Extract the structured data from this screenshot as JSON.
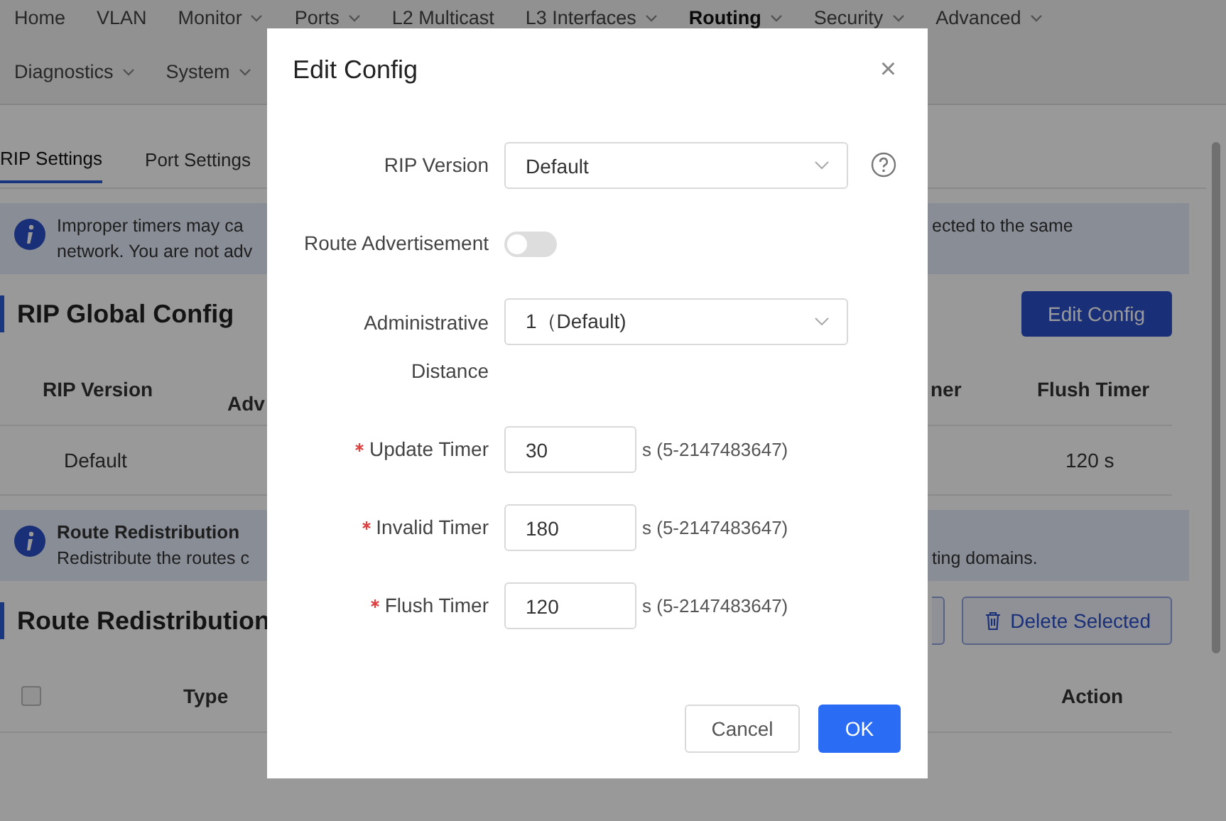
{
  "nav": [
    {
      "label": "Home",
      "has_menu": false,
      "selected": false
    },
    {
      "label": "VLAN",
      "has_menu": false,
      "selected": false
    },
    {
      "label": "Monitor",
      "has_menu": true,
      "selected": false
    },
    {
      "label": "Ports",
      "has_menu": true,
      "selected": false
    },
    {
      "label": "L2 Multicast",
      "has_menu": false,
      "selected": false
    },
    {
      "label": "L3 Interfaces",
      "has_menu": true,
      "selected": false
    },
    {
      "label": "Routing",
      "has_menu": true,
      "selected": true
    },
    {
      "label": "Security",
      "has_menu": true,
      "selected": false
    },
    {
      "label": "Advanced",
      "has_menu": true,
      "selected": false
    },
    {
      "label": "Diagnostics",
      "has_menu": true,
      "selected": false
    },
    {
      "label": "System",
      "has_menu": true,
      "selected": false
    }
  ],
  "tabs": [
    {
      "label": "RIP Settings",
      "selected": true
    },
    {
      "label": "Port Settings",
      "selected": false
    }
  ],
  "timer_notice": {
    "left_lines": [
      "Improper timers may ca",
      "network. You are not adv"
    ],
    "right_lines": [
      "ected to the same"
    ]
  },
  "global_config": {
    "title": "RIP Global Config",
    "button": "Edit Config",
    "columns": [
      "RIP Version",
      "Adv",
      "ner",
      "Flush Timer"
    ],
    "row": [
      "Default",
      "120 s"
    ]
  },
  "redistribution_notice": {
    "title": "Route Redistribution",
    "left_lines": [
      "Redistribute the routes c"
    ],
    "right_lines": [
      "ting domains."
    ]
  },
  "redistribution": {
    "title": "Route Redistribution",
    "delete_button": "Delete Selected",
    "columns": [
      "Type",
      "Action"
    ],
    "select_all": false
  },
  "dialog": {
    "title": "Edit Config",
    "close": "×",
    "fields": [
      {
        "kind": "select",
        "label": "RIP Version",
        "required": false,
        "value": "Default",
        "help": true
      },
      {
        "kind": "switch",
        "label": "Route Advertisement",
        "required": false,
        "on": false
      },
      {
        "kind": "select",
        "label": "Administrative Distance",
        "required": false,
        "value": "1（Default)",
        "help": false
      },
      {
        "kind": "number",
        "label": "Update Timer",
        "required": true,
        "value": "30",
        "hint": "s (5-2147483647)"
      },
      {
        "kind": "number",
        "label": "Invalid Timer",
        "required": true,
        "value": "180",
        "hint": "s (5-2147483647)"
      },
      {
        "kind": "number",
        "label": "Flush Timer",
        "required": true,
        "value": "120",
        "hint": "s (5-2147483647)"
      }
    ],
    "buttons": [
      {
        "kind": "secondary",
        "label": "Cancel"
      },
      {
        "kind": "primary",
        "label": "OK"
      }
    ]
  }
}
